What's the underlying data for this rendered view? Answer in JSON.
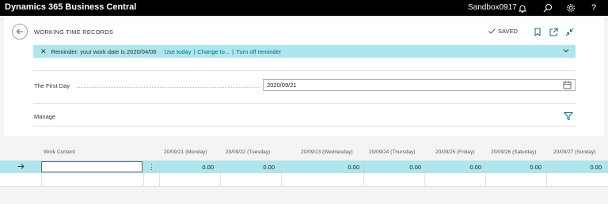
{
  "topbar": {
    "app_title": "Dynamics 365 Business Central",
    "environment": "Sandbox0917",
    "icons": [
      "bell-icon",
      "search-icon",
      "gear-icon",
      "help-icon"
    ],
    "help_glyph": "?"
  },
  "header": {
    "title": "WORKING TIME RECORDS",
    "saved_label": "SAVED",
    "icons": [
      "back-arrow-icon",
      "bookmark-icon",
      "open-new-window-icon",
      "collapse-icon"
    ]
  },
  "reminder": {
    "close_glyph": "✕",
    "message": "Reminder: your work date is 2020/04/06",
    "use_today": "Use today",
    "sep1": "|",
    "change_to": "Change to...",
    "sep2": "|",
    "turn_off": "Turn off reminder"
  },
  "first_day": {
    "label": "The First Day",
    "value": "2020/09/21"
  },
  "manage": {
    "label": "Manage"
  },
  "grid": {
    "columns": [
      "Work Content",
      "20/09/21 (Monday)",
      "20/09/22 (Tuesday)",
      "20/09/23 (Wednesday)",
      "20/09/24 (Thursday)",
      "20/09/25 (Friday)",
      "20/09/26 (Saturday)",
      "20/09/27 (Sunday)"
    ],
    "rows": [
      {
        "work_content": "",
        "values": [
          "0.00",
          "0.00",
          "0.00",
          "0.00",
          "0.00",
          "0.00",
          "0.00"
        ]
      }
    ]
  },
  "colors": {
    "topbar": "#000000",
    "highlight": "#ade6ed",
    "link": "#0b6a86"
  }
}
